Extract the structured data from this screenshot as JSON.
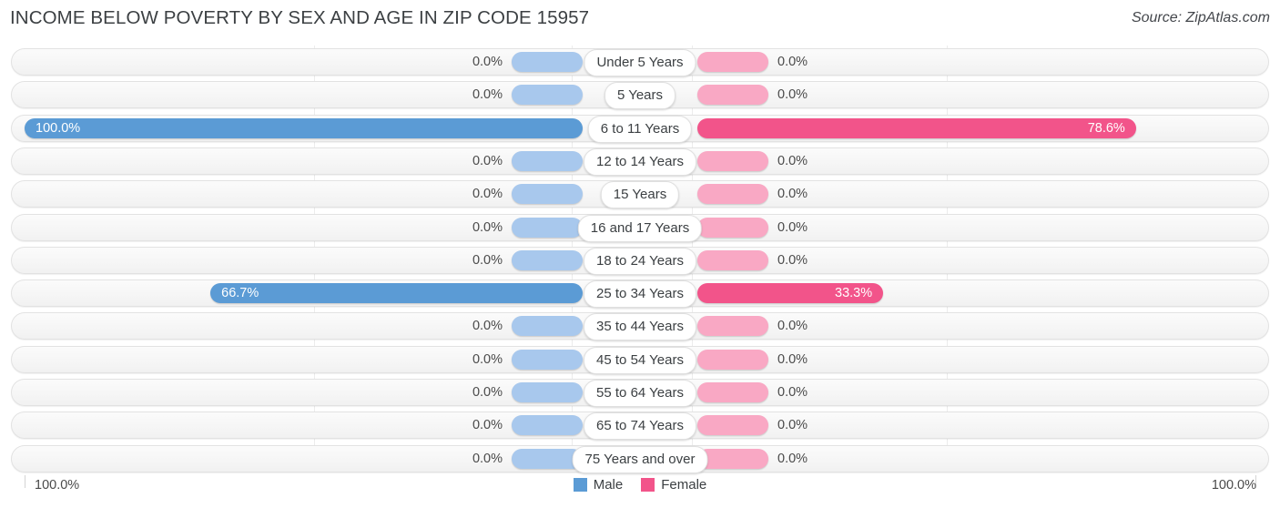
{
  "header": {
    "title": "INCOME BELOW POVERTY BY SEX AND AGE IN ZIP CODE 15957",
    "source": "Source: ZipAtlas.com"
  },
  "axis": {
    "left_label": "100.0%",
    "right_label": "100.0%",
    "max": 100.0
  },
  "legend": [
    {
      "label": "Male",
      "color": "#5b9bd5"
    },
    {
      "label": "Female",
      "color": "#f2548a"
    }
  ],
  "colors": {
    "male_light": "#a8c8ed",
    "male_strong": "#5b9bd5",
    "female_light": "#f9a8c4",
    "female_strong": "#f2548a",
    "track": "#f6f6f6"
  },
  "chart_data": {
    "type": "bar",
    "title": "INCOME BELOW POVERTY BY SEX AND AGE IN ZIP CODE 15957",
    "xlabel": "",
    "ylabel": "",
    "orientation": "horizontal-diverging",
    "xlim": [
      0,
      100
    ],
    "grid": false,
    "legend_position": "bottom-center",
    "categories": [
      "Under 5 Years",
      "5 Years",
      "6 to 11 Years",
      "12 to 14 Years",
      "15 Years",
      "16 and 17 Years",
      "18 to 24 Years",
      "25 to 34 Years",
      "35 to 44 Years",
      "45 to 54 Years",
      "55 to 64 Years",
      "65 to 74 Years",
      "75 Years and over"
    ],
    "series": [
      {
        "name": "Male",
        "values": [
          0.0,
          0.0,
          100.0,
          0.0,
          0.0,
          0.0,
          0.0,
          66.7,
          0.0,
          0.0,
          0.0,
          0.0,
          0.0
        ],
        "labels": [
          "0.0%",
          "0.0%",
          "100.0%",
          "0.0%",
          "0.0%",
          "0.0%",
          "0.0%",
          "66.7%",
          "0.0%",
          "0.0%",
          "0.0%",
          "0.0%",
          "0.0%"
        ]
      },
      {
        "name": "Female",
        "values": [
          0.0,
          0.0,
          78.6,
          0.0,
          0.0,
          0.0,
          0.0,
          33.3,
          0.0,
          0.0,
          0.0,
          0.0,
          0.0
        ],
        "labels": [
          "0.0%",
          "0.0%",
          "78.6%",
          "0.0%",
          "0.0%",
          "0.0%",
          "0.0%",
          "33.3%",
          "0.0%",
          "0.0%",
          "0.0%",
          "0.0%",
          "0.0%"
        ]
      }
    ]
  }
}
